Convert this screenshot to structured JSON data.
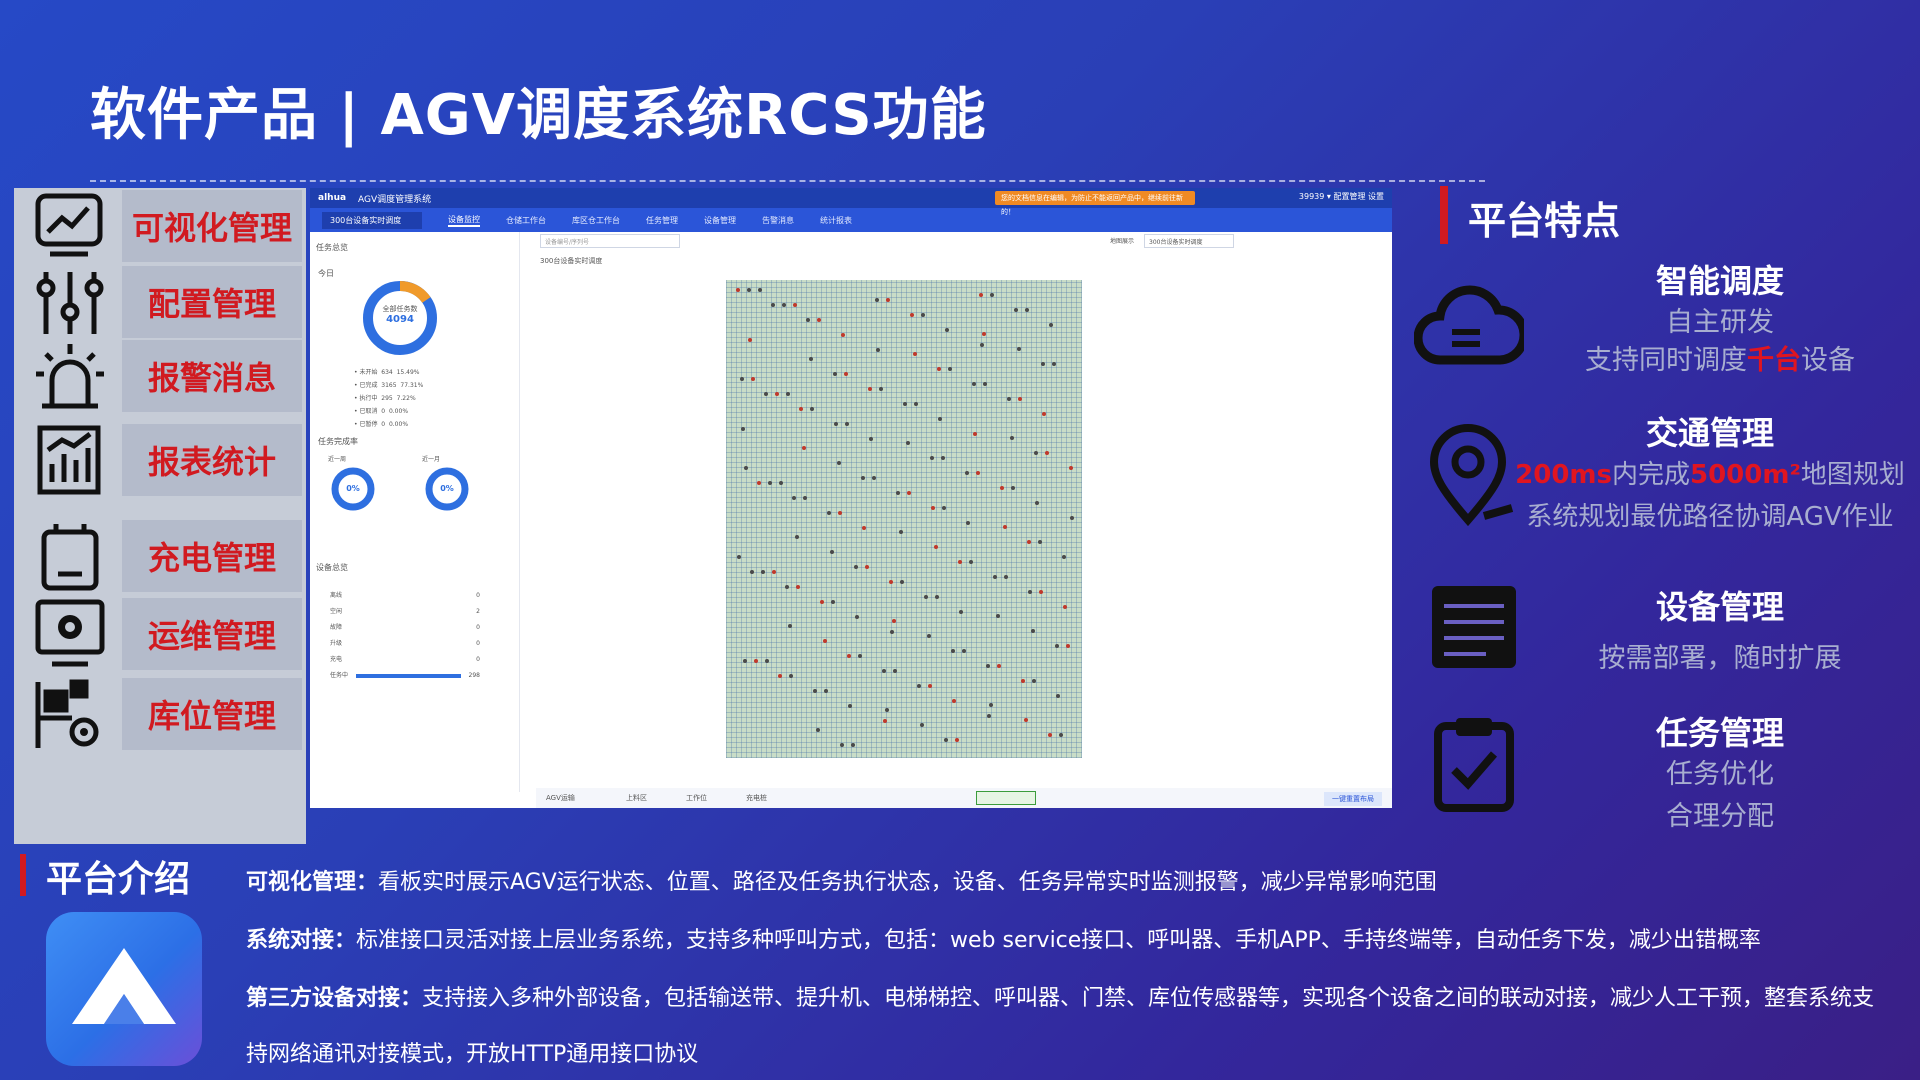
{
  "title": "软件产品 | AGV调度系统RCS功能",
  "menu": [
    {
      "label": "可视化管理",
      "icon": "monitor-chart-icon"
    },
    {
      "label": "配置管理",
      "icon": "sliders-icon"
    },
    {
      "label": "报警消息",
      "icon": "alarm-light-icon"
    },
    {
      "label": "报表统计",
      "icon": "report-chart-icon"
    },
    {
      "label": "充电管理",
      "icon": "battery-icon"
    },
    {
      "label": "运维管理",
      "icon": "gear-monitor-icon"
    },
    {
      "label": "库位管理",
      "icon": "warehouse-gear-icon"
    }
  ],
  "screenshot": {
    "brand": "alhua",
    "app_title": "AGV调度管理系统",
    "warning": "您的文档信息在编辑，为防止不能返回产品中，继续前往新的！",
    "top_right": "39939 ▾  配置管理  设置",
    "selector": "300台设备实时调度",
    "tabs": [
      "设备监控",
      "仓储工作台",
      "库区仓工作台",
      "任务管理",
      "设备管理",
      "告警消息",
      "统计报表"
    ],
    "left": {
      "section1": "任务总览",
      "today": "今日",
      "donut_label": "全部任务数",
      "donut_value": "4094",
      "stats": [
        {
          "label": "未开始",
          "count": "634",
          "pct": "15.49%"
        },
        {
          "label": "已完成",
          "count": "3165",
          "pct": "77.31%"
        },
        {
          "label": "执行中",
          "count": "295",
          "pct": "7.22%"
        },
        {
          "label": "已取消",
          "count": "0",
          "pct": "0.00%"
        },
        {
          "label": "已暂停",
          "count": "0",
          "pct": "0.00%"
        }
      ],
      "section2": "任务完成率",
      "rate1_label": "近一周",
      "rate2_label": "近一月",
      "rate1": "0%",
      "rate2": "0%",
      "section3": "设备总览",
      "devices": [
        {
          "label": "离线",
          "value": "0"
        },
        {
          "label": "空闲",
          "value": "2"
        },
        {
          "label": "故障",
          "value": "0"
        },
        {
          "label": "升级",
          "value": "0"
        },
        {
          "label": "充电",
          "value": "0"
        },
        {
          "label": "任务中",
          "value": "298"
        }
      ]
    },
    "main": {
      "search_placeholder": "设备编号/序列号",
      "map_label": "地图展示",
      "map_select": "300台设备实时调度",
      "panel_title": "300台设备实时调度"
    },
    "bottom": {
      "agv": "AGV运输",
      "slot": "上料区",
      "station": "工作位",
      "charge": "充电桩",
      "button": "一键重置布局"
    }
  },
  "features": {
    "heading": "平台特点",
    "items": [
      {
        "title": "智能调度",
        "lines": [
          "自主研发",
          "支持同时调度",
          "千台",
          "设备"
        ]
      },
      {
        "title": "交通管理",
        "lines": [
          "200ms",
          "内完成",
          "5000m²",
          "地图规划",
          "系统规划最优路径协调AGV作业"
        ]
      },
      {
        "title": "设备管理",
        "lines": [
          "按需部署，随时扩展"
        ]
      },
      {
        "title": "任务管理",
        "lines": [
          "任务优化",
          "合理分配"
        ]
      }
    ]
  },
  "intro": {
    "heading": "平台介绍",
    "paragraphs": [
      {
        "bold": "可视化管理：",
        "text": "看板实时展示AGV运行状态、位置、路径及任务执行状态，设备、任务异常实时监测报警，减少异常影响范围"
      },
      {
        "bold": "系统对接：",
        "text": "标准接口灵活对接上层业务系统，支持多种呼叫方式，包括：web service接口、呼叫器、手机APP、手持终端等，自动任务下发，减少出错概率"
      },
      {
        "bold": "第三方设备对接：",
        "text": "支持接入多种外部设备，包括输送带、提升机、电梯梯控、呼叫器、门禁、库位传感器等，实现各个设备之间的联动对接，减少人工干预，整套系统支",
        "text2": "持网络通讯对接模式，开放HTTP通用接口协议"
      }
    ]
  }
}
